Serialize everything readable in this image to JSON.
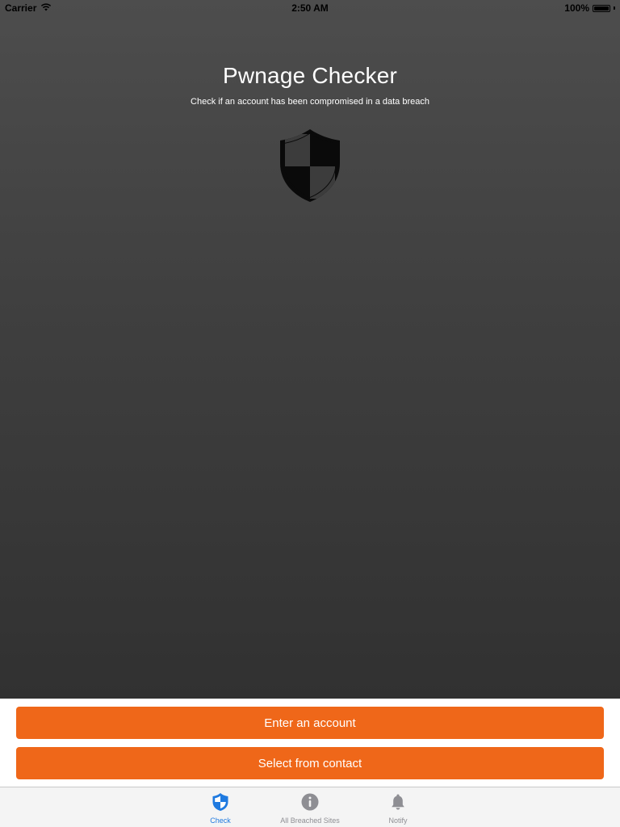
{
  "status_bar": {
    "carrier": "Carrier",
    "time": "2:50 AM",
    "battery": "100%"
  },
  "header": {
    "title": "Pwnage Checker",
    "subtitle": "Check if an account has been compromised in a data breach"
  },
  "logo": {
    "icon": "shield-icon"
  },
  "actions": {
    "enter_account": "Enter an account",
    "select_contact": "Select from contact"
  },
  "tabs": [
    {
      "label": "Check",
      "icon": "shield-icon",
      "active": true
    },
    {
      "label": "All Breached Sites",
      "icon": "info-icon",
      "active": false
    },
    {
      "label": "Notify",
      "icon": "bell-icon",
      "active": false
    }
  ],
  "colors": {
    "accent": "#ef6719",
    "tab_active": "#1f7ae0",
    "tab_inactive": "#8e8e93",
    "hero_top": "#4d4d4d",
    "hero_bottom": "#313131"
  }
}
